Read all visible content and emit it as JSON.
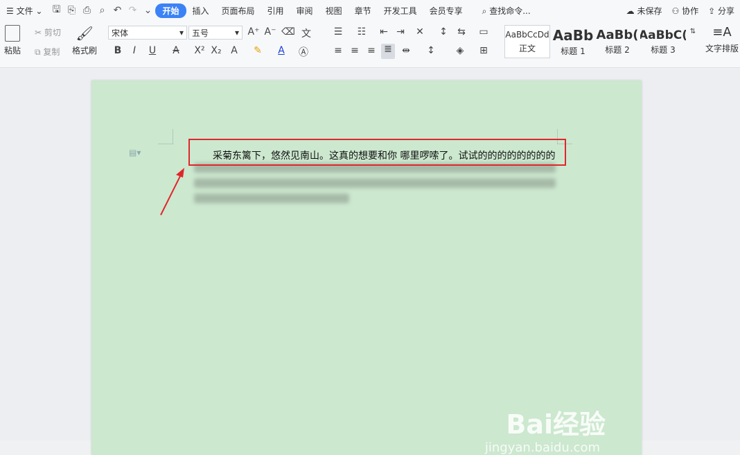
{
  "menubar": {
    "file": "文件",
    "tabs": [
      "开始",
      "插入",
      "页面布局",
      "引用",
      "审阅",
      "视图",
      "章节",
      "开发工具",
      "会员专享"
    ],
    "search_placeholder": "查找命令...",
    "unsaved": "未保存",
    "collab": "协作",
    "share": "分享"
  },
  "ribbon": {
    "paste": "粘贴",
    "cut": "剪切",
    "copy": "复制",
    "format_painter": "格式刷",
    "font_name": "宋体",
    "font_size": "五号",
    "styles": [
      {
        "preview": "AaBbCcDd",
        "label": "正文"
      },
      {
        "preview": "AaBb",
        "label": "标题 1"
      },
      {
        "preview": "AaBb(",
        "label": "标题 2"
      },
      {
        "preview": "AaBbC(",
        "label": "标题 3"
      }
    ],
    "text_layout": "文字排版"
  },
  "document": {
    "first_line": "采菊东篱下，悠然见南山。这真的想要和你 哪里啰嗦了。试试的的的的的的的的"
  },
  "watermark": {
    "brand": "Bai经验",
    "url": "jingyan.baidu.com"
  }
}
